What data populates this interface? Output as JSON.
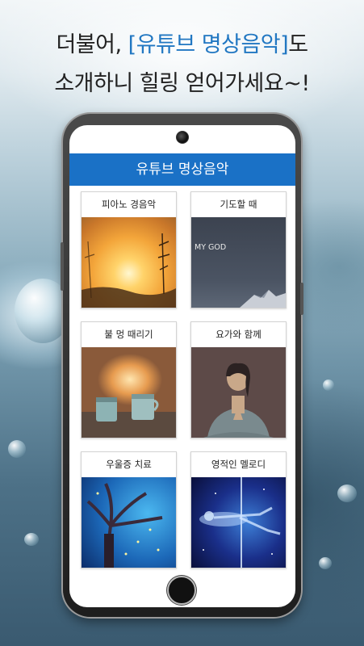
{
  "headline": {
    "line1_prefix": "더불어, ",
    "line1_highlight": "[유튜브 명상음악]",
    "line1_suffix": "도",
    "line2": "소개하니 힐링 얻어가세요~!"
  },
  "colors": {
    "accent": "#1a71c6",
    "highlight_text": "#2177c2"
  },
  "app": {
    "banner_title": "유튜브 명상음악",
    "cards": [
      {
        "label": "피아노 경음악",
        "image": "sunset-piano"
      },
      {
        "label": "기도할 때",
        "image": "my-god-mountain",
        "image_text": "MY GOD"
      },
      {
        "label": "불 멍 때리기",
        "image": "campfire-mugs"
      },
      {
        "label": "요가와 함께",
        "image": "yoga-meditation"
      },
      {
        "label": "우울증 치료",
        "image": "glowing-tree"
      },
      {
        "label": "영적인 멜로디",
        "image": "spirit-body"
      }
    ]
  }
}
